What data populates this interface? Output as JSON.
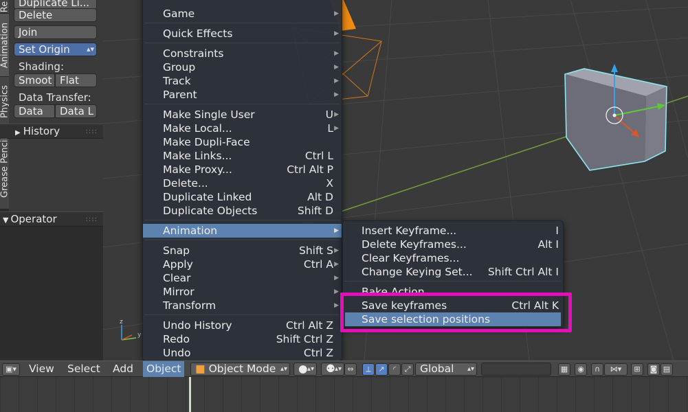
{
  "side_tabs": [
    "Grease Pencil",
    "Physics",
    "Animation",
    "Re"
  ],
  "tool_shelf": {
    "duplicate_linked": "Duplicate Li...",
    "delete": "Delete",
    "join": "Join",
    "set_origin": "Set Origin",
    "shading_label": "Shading:",
    "smooth": "Smoot",
    "flat": "Flat",
    "data_transfer_label": "Data Transfer:",
    "data": "Data",
    "data_l": "Data L",
    "history_panel": "History",
    "operator_panel": "Operator"
  },
  "object_menu": {
    "items": [
      {
        "label": "Game",
        "shortcut": "",
        "submenu": true
      },
      {
        "label": "Quick Effects",
        "shortcut": "",
        "submenu": true
      },
      {
        "label": "Constraints",
        "shortcut": "",
        "submenu": true
      },
      {
        "label": "Group",
        "shortcut": "",
        "submenu": true
      },
      {
        "label": "Track",
        "shortcut": "",
        "submenu": true
      },
      {
        "label": "Parent",
        "shortcut": "",
        "submenu": true
      },
      {
        "label": "Make Single User",
        "shortcut": "U",
        "submenu": true
      },
      {
        "label": "Make Local...",
        "shortcut": "L",
        "submenu": true
      },
      {
        "label": "Make Dupli-Face",
        "shortcut": "",
        "submenu": false
      },
      {
        "label": "Make Links...",
        "shortcut": "Ctrl L",
        "submenu": false
      },
      {
        "label": "Make Proxy...",
        "shortcut": "Ctrl Alt P",
        "submenu": false
      },
      {
        "label": "Delete...",
        "shortcut": "X",
        "submenu": false
      },
      {
        "label": "Duplicate Linked",
        "shortcut": "Alt D",
        "submenu": false
      },
      {
        "label": "Duplicate Objects",
        "shortcut": "Shift D",
        "submenu": false
      },
      {
        "label": "Animation",
        "shortcut": "",
        "submenu": true
      },
      {
        "label": "Snap",
        "shortcut": "Shift S",
        "submenu": true
      },
      {
        "label": "Apply",
        "shortcut": "Ctrl A",
        "submenu": true
      },
      {
        "label": "Clear",
        "shortcut": "",
        "submenu": true
      },
      {
        "label": "Mirror",
        "shortcut": "",
        "submenu": true
      },
      {
        "label": "Transform",
        "shortcut": "",
        "submenu": true
      },
      {
        "label": "Undo History",
        "shortcut": "Ctrl Alt Z",
        "submenu": false
      },
      {
        "label": "Redo",
        "shortcut": "Shift Ctrl Z",
        "submenu": false
      },
      {
        "label": "Undo",
        "shortcut": "Ctrl Z",
        "submenu": false
      }
    ]
  },
  "animation_submenu": {
    "items": [
      {
        "label": "Insert Keyframe...",
        "shortcut": "I"
      },
      {
        "label": "Delete Keyframes...",
        "shortcut": "Alt I"
      },
      {
        "label": "Clear Keyframes...",
        "shortcut": ""
      },
      {
        "label": "Change Keying Set...",
        "shortcut": "Shift Ctrl Alt I"
      },
      {
        "label": "Bake Action",
        "shortcut": ""
      },
      {
        "label": "Save keyframes",
        "shortcut": "Ctrl Alt K"
      },
      {
        "label": "Save selection positions",
        "shortcut": ""
      }
    ]
  },
  "header": {
    "view": "View",
    "select": "Select",
    "add": "Add",
    "object": "Object",
    "mode": "Object Mode",
    "orientation": "Global"
  },
  "colors": {
    "highlight": "#5e82b0",
    "annotation": "#e50fb8",
    "selected_outline": "#8de6f0"
  }
}
